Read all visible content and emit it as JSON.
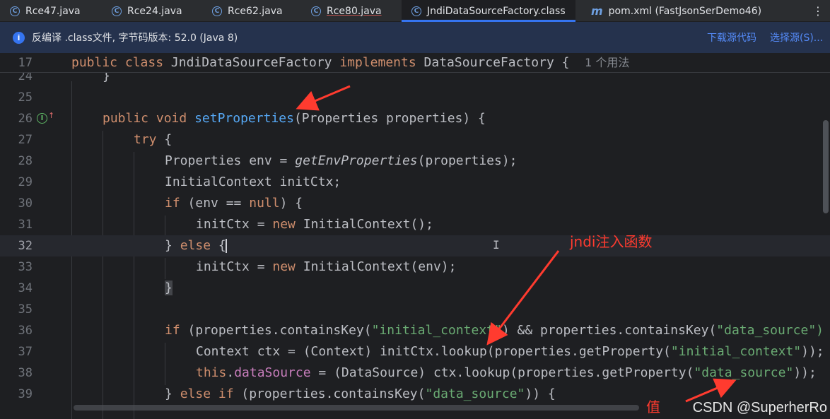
{
  "tabs": [
    {
      "label": "Rce47.java",
      "icon": "class-icon",
      "active": false
    },
    {
      "label": "Rce24.java",
      "icon": "class-icon",
      "active": false
    },
    {
      "label": "Rce62.java",
      "icon": "class-icon",
      "active": false
    },
    {
      "label": "Rce80.java",
      "icon": "class-icon",
      "active": false
    },
    {
      "label": "JndiDataSourceFactory.class",
      "icon": "class-icon",
      "active": true
    },
    {
      "label": "pom.xml (FastJsonSerDemo46)",
      "icon": "maven-icon",
      "active": false
    }
  ],
  "more_label": "⋮",
  "banner": {
    "text": "反编译 .class文件, 字节码版本: 52.0 (Java 8)",
    "download_link": "下载源代码",
    "choose_link": "选择源(S)..."
  },
  "sticky": {
    "line_no": "17",
    "kw1": "public",
    "kw2": "class",
    "name": "JndiDataSourceFactory",
    "kw3": "implements",
    "iface": "DataSourceFactory {",
    "hint": "1 个用法"
  },
  "lines": {
    "l24": {
      "no": "24",
      "code": "}"
    },
    "l25": {
      "no": "25"
    },
    "l26": {
      "no": "26",
      "kw1": "public",
      "kw2": "void",
      "fn": "setProperties",
      "rest": "(Properties properties) {"
    },
    "l27": {
      "no": "27",
      "kw": "try",
      "rest": " {"
    },
    "l28": {
      "no": "28",
      "a": "Properties env = ",
      "call": "getEnvProperties",
      "b": "(properties);"
    },
    "l29": {
      "no": "29",
      "a": "InitialContext initCtx;"
    },
    "l30": {
      "no": "30",
      "kw": "if",
      "a": " (env == ",
      "kw2": "null",
      "b": ") {"
    },
    "l31": {
      "no": "31",
      "a": "initCtx = ",
      "kw": "new",
      "b": " InitialContext();"
    },
    "l32": {
      "no": "32",
      "a": "} ",
      "kw": "else",
      "b": " {"
    },
    "l33": {
      "no": "33",
      "a": "initCtx = ",
      "kw": "new",
      "b": " InitialContext(env);"
    },
    "l34": {
      "no": "34",
      "a": "}"
    },
    "l35": {
      "no": "35"
    },
    "l36": {
      "no": "36",
      "kw": "if",
      "a": " (properties.containsKey(",
      "s1": "\"initial_context\"",
      "b": ") && properties.containsKey(",
      "s2": "\"data_source\")"
    },
    "l37": {
      "no": "37",
      "a": "Context ctx = (Context) initCtx.lookup(properties.getProperty(",
      "s1": "\"initial_context\"",
      "b": "));"
    },
    "l38": {
      "no": "38",
      "kw": "this",
      "a": ".",
      "fld": "dataSource",
      "b": " = (DataSource) ctx.lookup(properties.getProperty(",
      "s1": "\"data_source\"",
      "c": "));"
    },
    "l39": {
      "no": "39",
      "a": "} ",
      "kw": "else if",
      "b": " (properties.containsKey(",
      "s1": "\"data_source\"",
      "c": ")) {"
    }
  },
  "annotations": {
    "jndi": "jndi注入函数",
    "value": "值"
  },
  "watermark": "CSDN @SuperherRo",
  "colors": {
    "keyword": "#cf8e6d",
    "function": "#56a8f5",
    "string": "#6aab73",
    "field": "#c77dbb",
    "annotation": "#ff3b2f",
    "accent": "#3574f0"
  }
}
